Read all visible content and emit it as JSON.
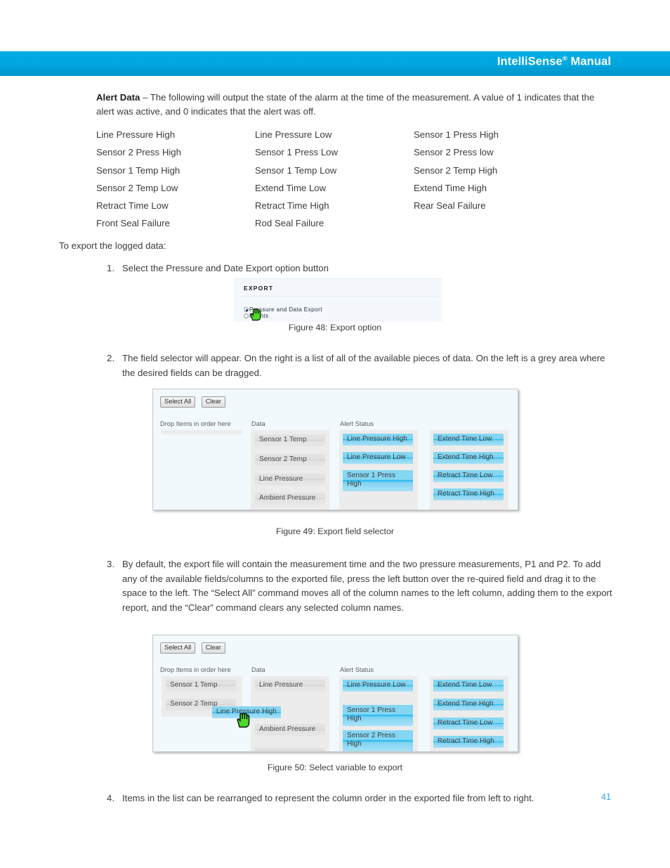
{
  "header": {
    "title_main": "IntelliSense",
    "title_sup": "®",
    "title_tail": " Manual"
  },
  "intro": {
    "bold": "Alert Data",
    "text": " – The following will output the state of the alarm at the time of the measurement. A value of 1 indicates that the alert was active, and 0 indicates that the alert was off."
  },
  "alert_data_fields": [
    "Line Pressure High",
    "Line Pressure Low",
    "Sensor 1 Press High",
    "Sensor 2 Press High",
    "Sensor 1 Press Low",
    "Sensor 2 Press low",
    "Sensor 1 Temp High",
    "Sensor 1 Temp Low",
    "Sensor 2 Temp High",
    "Sensor 2 Temp Low",
    "Extend Time Low",
    "Extend Time High",
    "Retract Time Low",
    "Retract Time High",
    "Rear Seal Failure",
    "Front Seal Failure",
    "Rod Seal Failure",
    ""
  ],
  "lead_line": "To export the logged data:",
  "steps": [
    {
      "num": "1.",
      "text": "Select the Pressure and Date Export option button"
    },
    {
      "num": "2.",
      "text": "The field selector will appear. On the right is a list of all of the available pieces of data. On the left is a grey area where the desired fields can be dragged."
    },
    {
      "num": "3.",
      "text": "By default, the export file will contain the measurement time and the two pressure measurements, P1 and P2. To add any of the available fields/columns to the exported file, press the left button over the re-quired field and drag it to the space to the left. The “Select All” command moves all of the column names to the left column, adding them to the export report, and the “Clear” command clears any selected column names."
    },
    {
      "num": "4.",
      "text": "Items in the list can be rearranged to represent the column order in the exported file from left to right."
    }
  ],
  "captions": {
    "fig48": "Figure 48: Export option",
    "fig49": "Figure 49: Export field selector",
    "fig50": "Figure 50: Select variable to export"
  },
  "page_number": "41",
  "figure48": {
    "panel_title": "EXPORT",
    "options": [
      {
        "label": "Pressure and Data Export",
        "selected": true
      },
      {
        "label": "Events",
        "selected": false
      }
    ]
  },
  "figure49": {
    "buttons": [
      "Select All",
      "Clear"
    ],
    "column_headers": [
      "Drop Items in order here",
      "Data",
      "Alert Status"
    ],
    "drop_zone_items": [],
    "data_items": [
      "Sensor 1 Temp",
      "Sensor 2 Temp",
      "Line Pressure",
      "Ambient Pressure"
    ],
    "alert_status_items": [
      "Line Pressure High",
      "Line Pressure Low",
      "Sensor 1 Press High"
    ],
    "alert_status_items_2": [
      "Extend Time Low",
      "Extend Time High",
      "Retract Time Low",
      "Retract Time High"
    ]
  },
  "figure50": {
    "buttons": [
      "Select All",
      "Clear"
    ],
    "column_headers": [
      "Drop Items in order here",
      "Data",
      "Alert Status"
    ],
    "drop_zone_items": [
      "Sensor 1 Temp",
      "Sensor 2 Temp"
    ],
    "dragged_item": "Line Pressure High",
    "data_items": [
      "Line Pressure",
      "Ambient Pressure"
    ],
    "alert_status_items": [
      "Line Pressure Low",
      "Sensor 1 Press High",
      "Sensor 2 Press High"
    ],
    "alert_status_items_2": [
      "Extend Time Low",
      "Extend Time High",
      "Retract Time Low",
      "Retract Time High"
    ]
  },
  "colors": {
    "header_band": "#00ade6",
    "page_number": "#29a8e0",
    "chip_blue": "#84d6f2",
    "chip_blue_accent": "#17b6ef",
    "chip_grey": "#e3e3e3",
    "shot_background": "#f1f9fc"
  }
}
